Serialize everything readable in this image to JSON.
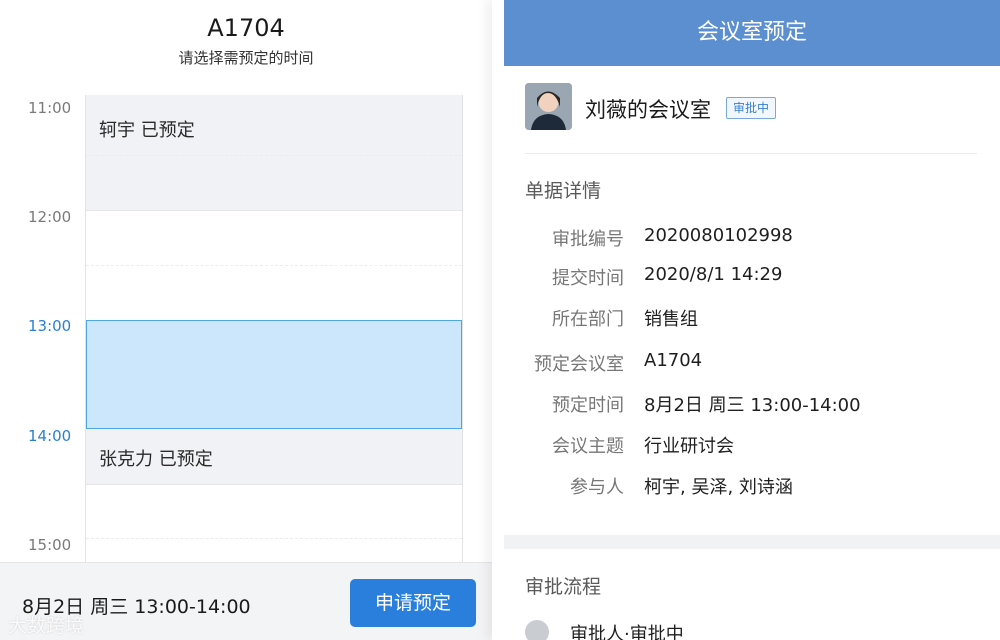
{
  "left": {
    "room": "A1704",
    "subtitle": "请选择需预定的时间",
    "times": [
      "11:00",
      "12:00",
      "13:00",
      "14:00",
      "15:00"
    ],
    "bookings": [
      {
        "label": "轲宇  已预定"
      },
      {
        "label": "张克力  已预定"
      }
    ],
    "selected_time": "8月2日 周三 13:00-14:00",
    "apply_button": "申请预定",
    "watermark": "大数跨境"
  },
  "right": {
    "header": "会议室预定",
    "applicant_title": "刘薇的会议室",
    "status": "审批中",
    "details_section": "单据详情",
    "details": [
      {
        "label": "审批编号",
        "value": "2020080102998"
      },
      {
        "label": "提交时间",
        "value": "2020/8/1  14:29"
      },
      {
        "label": "所在部门",
        "value": "销售组"
      },
      {
        "label": "预定会议室",
        "value": "A1704"
      },
      {
        "label": "预定时间",
        "value": "8月2日 周三 13:00-14:00"
      },
      {
        "label": "会议主题",
        "value": "行业研讨会"
      },
      {
        "label": "参与人",
        "value": "柯宇, 吴泽, 刘诗涵"
      }
    ],
    "flow_section": "审批流程",
    "flow_item": "审批人·审批中"
  },
  "colors": {
    "accent": "#2b7fdc",
    "header": "#5b8fd0",
    "selection": "#cce7fb",
    "booked": "#f1f2f5"
  }
}
